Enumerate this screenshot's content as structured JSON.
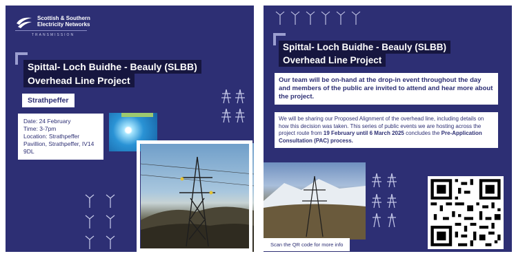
{
  "logo": {
    "line1": "Scottish & Southern",
    "line2": "Electricity Networks",
    "sub": "TRANSMISSION"
  },
  "left": {
    "title_line1": "Spittal- Loch Buidhe - Beauly (SLBB)",
    "title_line2": "Overhead Line Project",
    "location": "Strathpeffer",
    "details": [
      "Date: 24 February",
      "Time: 3-7pm",
      "Location: Strathpeffer",
      "Pavillion, Strathpeffer, IV14",
      "9DL"
    ]
  },
  "right": {
    "title_line1": "Spittal- Loch Buidhe - Beauly (SLBB)",
    "title_line2": "Overhead Line Project",
    "para1": "Our team will be on-hand at the drop-in event throughout the day and members of the public are invited to attend and hear more about the project.",
    "para2_a": "We will be sharing our Proposed Alignment of the overhead line, including details on how this decision was taken. This series of public events we are hosting across the project route from ",
    "para2_b": "19 February until 6 March 2025",
    "para2_c": " concludes the ",
    "para2_d": "Pre-Application Consultation (PAC) process.",
    "scan": "Scan the QR code for more info"
  },
  "colors": {
    "navy": "#2d2f74",
    "dark": "#16163f",
    "accent": "#9c9fd0",
    "highlight": "#9dc96f"
  },
  "icons": [
    "sse-logo-icon",
    "pylon-icon",
    "wind-turbine-icon",
    "qr-code"
  ]
}
